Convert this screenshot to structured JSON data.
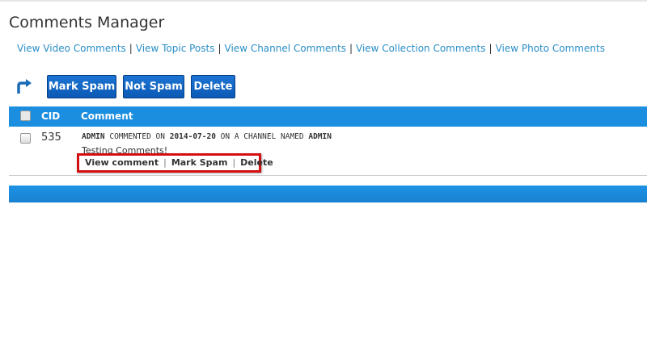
{
  "page": {
    "title": "Comments Manager"
  },
  "nav": {
    "links": [
      "View Video Comments",
      "View Topic Posts",
      "View Channel Comments",
      "View Collection Comments",
      "View Photo Comments"
    ],
    "separator": "|"
  },
  "toolbar": {
    "mark_spam_label": "Mark Spam",
    "not_spam_label": "Not Spam",
    "delete_label": "Delete",
    "arrow_icon": "redirect-arrow-icon"
  },
  "table": {
    "headers": {
      "cid": "CID",
      "comment": "Comment"
    },
    "rows": [
      {
        "cid": "535",
        "author": "ADMIN",
        "commented_on": "COMMENTED ON",
        "date": "2014-07-20",
        "on_channel": "ON A CHANNEL NAMED",
        "channel": "ADMIN",
        "text": "Testing Comments!",
        "actions": {
          "view": "View comment",
          "spam": "Mark Spam",
          "delete": "Delete",
          "separator": "|"
        }
      }
    ]
  },
  "colors": {
    "header_blue": "#1c8ee0",
    "button_blue": "#0b5ab5",
    "link_blue": "#2a8ec8",
    "highlight_red": "#d40f0f"
  }
}
